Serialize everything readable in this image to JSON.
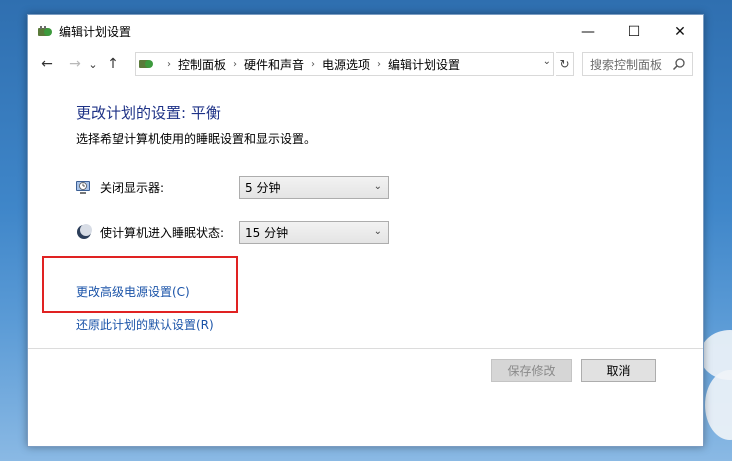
{
  "window": {
    "title": "编辑计划设置",
    "minimize_glyph": "—",
    "maximize_glyph": "☐",
    "close_glyph": "✕"
  },
  "nav": {
    "back_glyph": "←",
    "forward_glyph": "→",
    "recent_glyph": "⌄",
    "up_glyph": "↑"
  },
  "breadcrumb": [
    "控制面板",
    "硬件和声音",
    "电源选项",
    "编辑计划设置"
  ],
  "search": {
    "placeholder": "搜索控制面板"
  },
  "main": {
    "heading": "更改计划的设置: 平衡",
    "subheading": "选择希望计算机使用的睡眠设置和显示设置。",
    "settings": [
      {
        "label": "关闭显示器:",
        "value": "5 分钟",
        "icon": "monitor-clock-icon"
      },
      {
        "label": "使计算机进入睡眠状态:",
        "value": "15 分钟",
        "icon": "moon-icon"
      }
    ],
    "links": {
      "advanced": "更改高级电源设置(C)",
      "restore": "还原此计划的默认设置(R)"
    },
    "buttons": {
      "save": "保存修改",
      "cancel": "取消"
    }
  },
  "colors": {
    "heading": "#1e3287",
    "link": "#1a53a8",
    "highlight": "#e02222"
  }
}
